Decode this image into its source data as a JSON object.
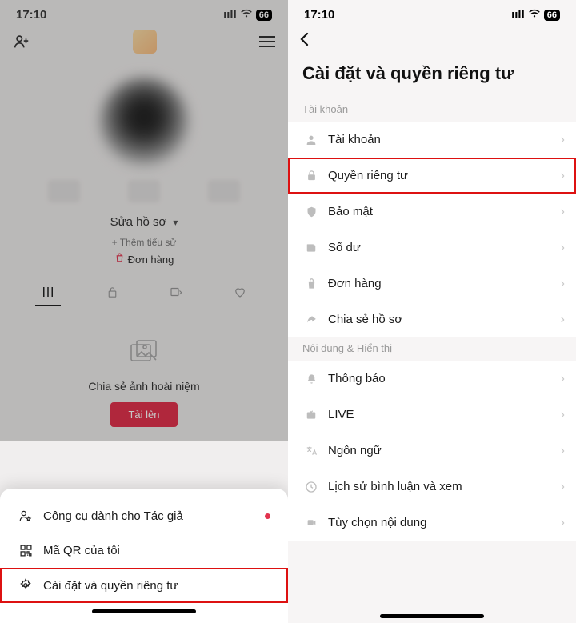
{
  "status": {
    "time": "17:10",
    "battery": "66"
  },
  "left": {
    "edit_profile": "Sửa hồ sơ",
    "add_bio": "+ Thêm tiểu sử",
    "orders": "Đơn hàng",
    "memory_title": "Chia sẻ ảnh hoài niệm",
    "upload": "Tải lên",
    "sheet": {
      "creator_tools": "Công cụ dành cho Tác giả",
      "qr": "Mã QR của tôi",
      "settings": "Cài đặt và quyền riêng tư"
    }
  },
  "right": {
    "title": "Cài đặt và quyền riêng tư",
    "section_account": "Tài khoản",
    "section_content": "Nội dung & Hiển thị",
    "items": {
      "account": "Tài khoản",
      "privacy": "Quyền riêng tư",
      "security": "Bảo mật",
      "balance": "Số dư",
      "orders": "Đơn hàng",
      "share": "Chia sẻ hồ sơ",
      "notif": "Thông báo",
      "live": "LIVE",
      "lang": "Ngôn ngữ",
      "history": "Lịch sử bình luận và xem",
      "content_pref": "Tùy chọn nội dung"
    }
  }
}
